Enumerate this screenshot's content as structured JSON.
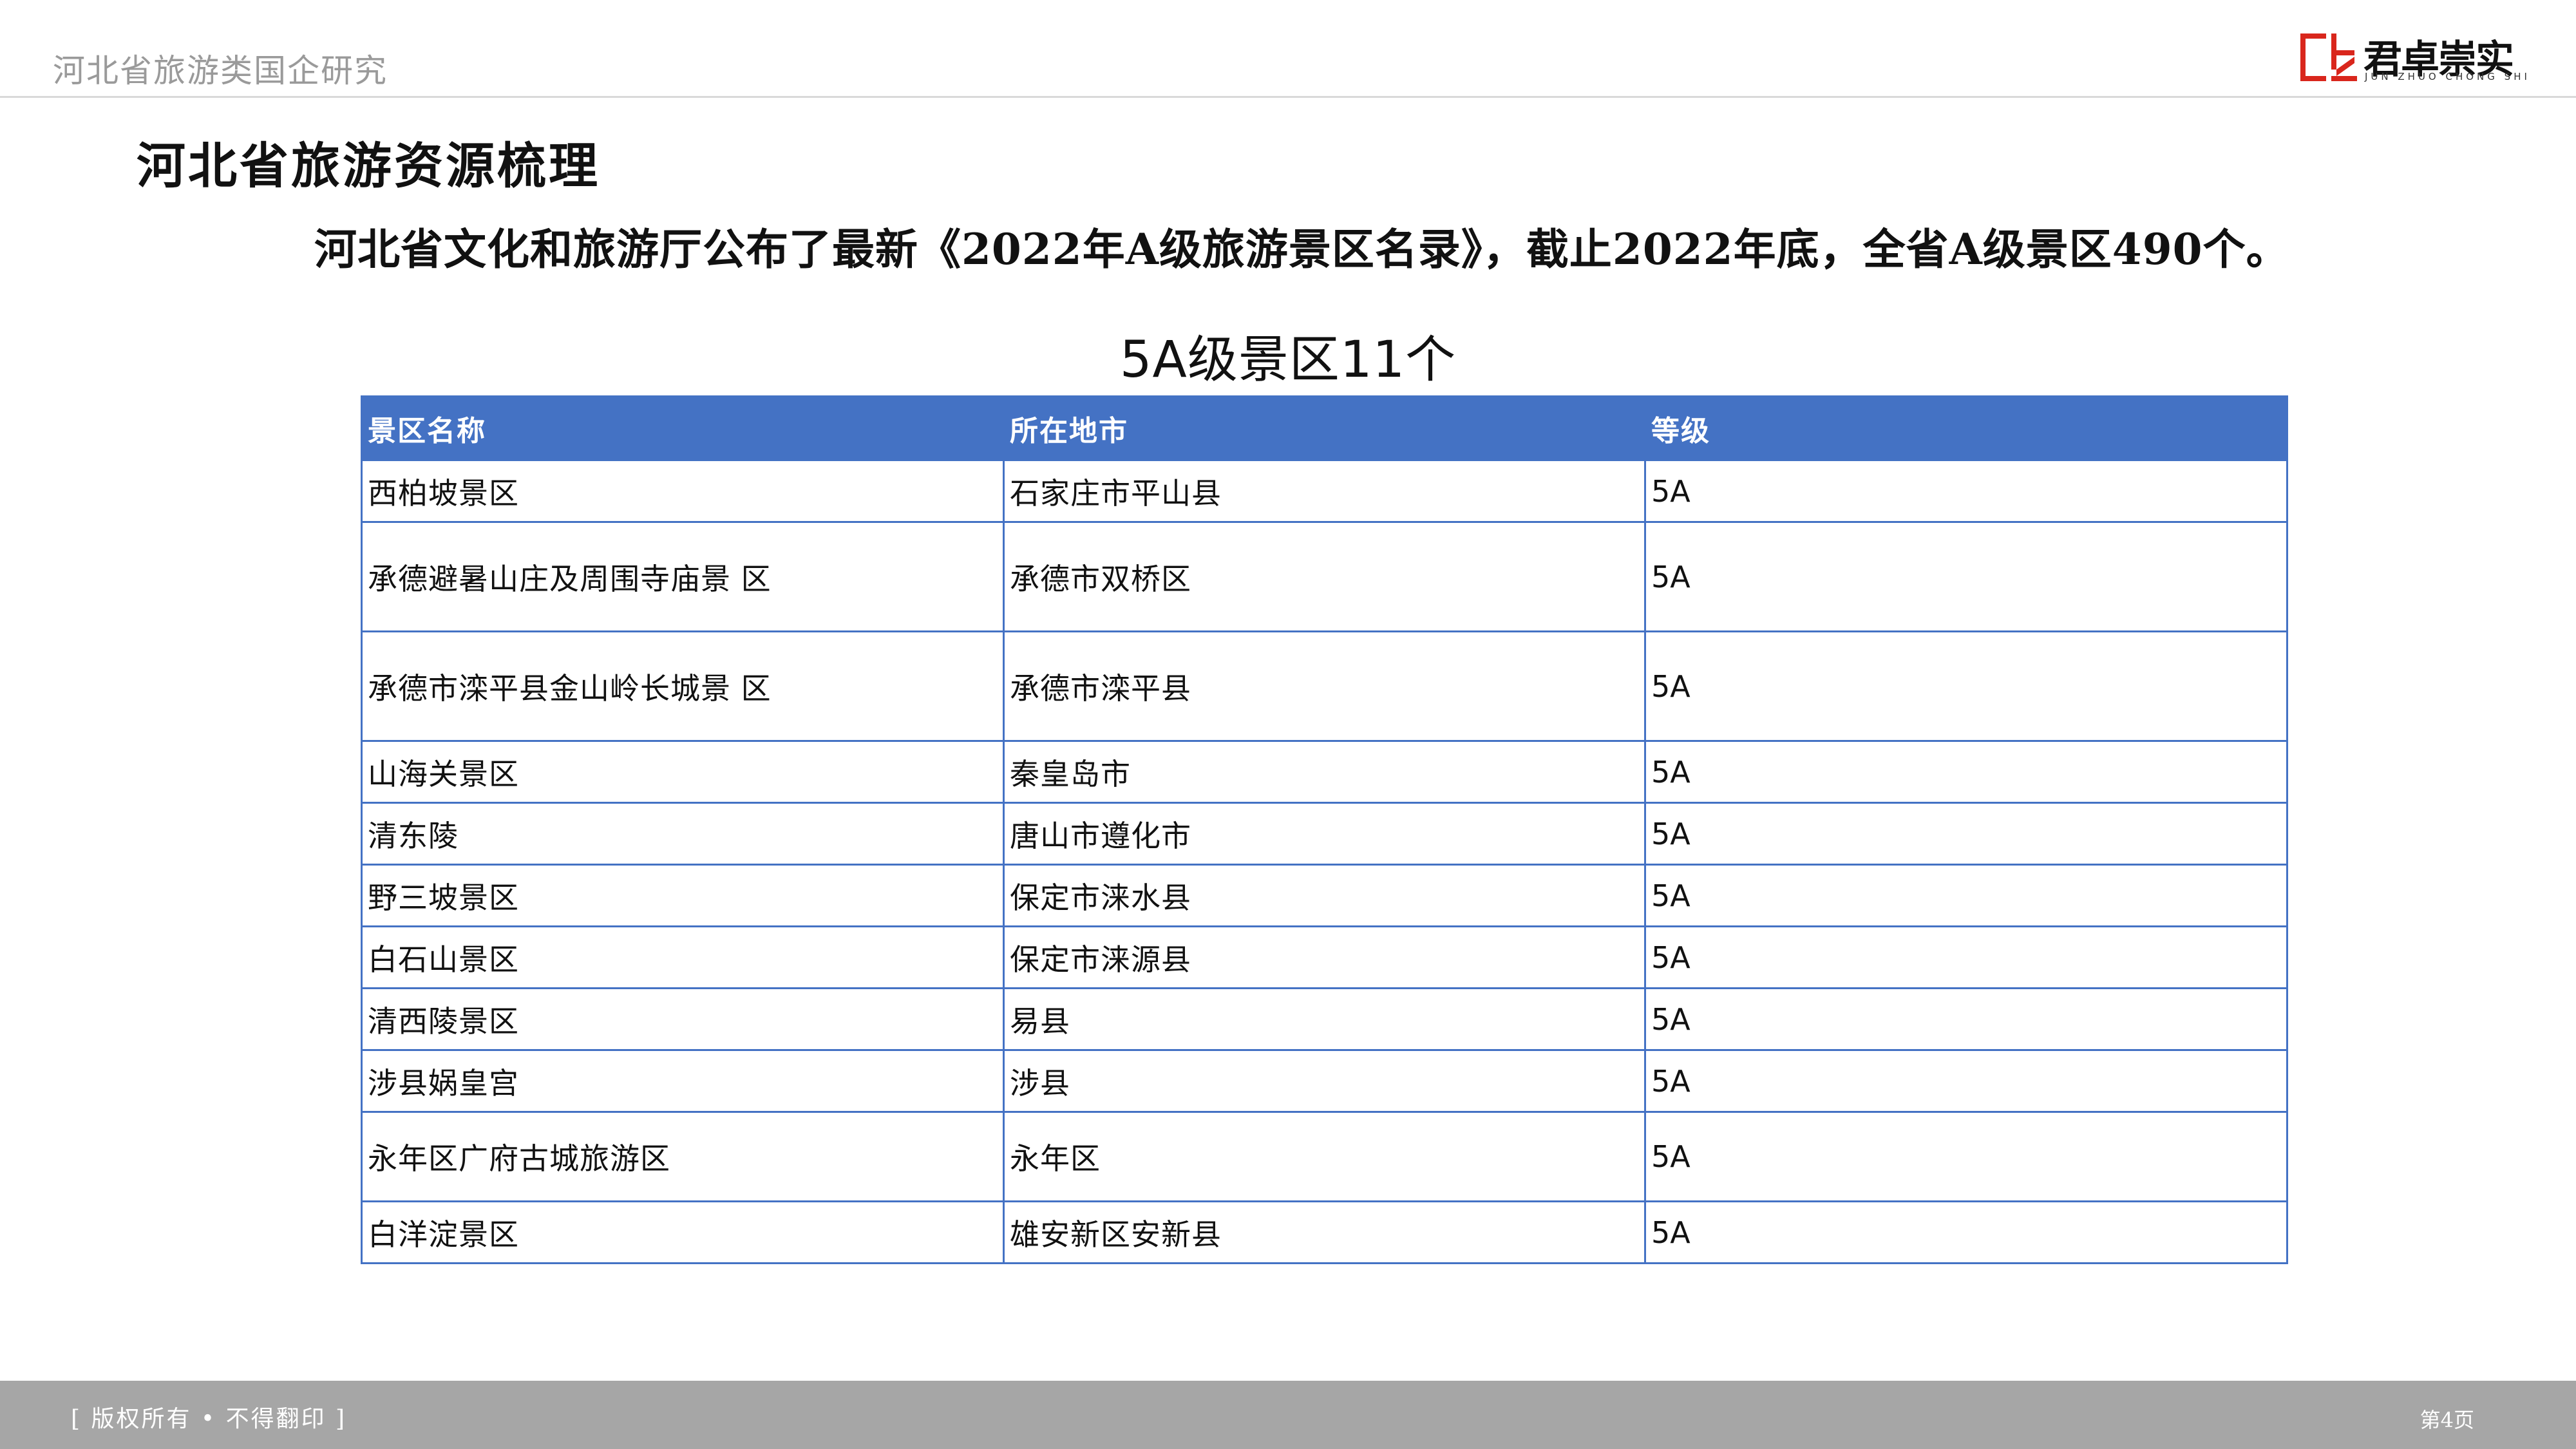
{
  "header": {
    "title": "河北省旅游类国企研究",
    "logo": {
      "name": "君卓崇实",
      "subtitle": "JUN ZHUO CHONG SHI",
      "colors": {
        "red": "#d9261c",
        "dark": "#111111"
      }
    }
  },
  "section_title": "河北省旅游资源梳理",
  "subtitle": "河北省文化和旅游厅公布了最新《2022年A级旅游景区名录》，截止2022年底，全省A级景区490个。",
  "table": {
    "caption": "5A级景区11个",
    "header_color": "#4472c4",
    "columns": [
      "景区名称",
      "所在地市",
      "等级"
    ],
    "rows": [
      [
        "西柏坡景区",
        "石家庄市平山县",
        "5A"
      ],
      [
        "承德避暑山庄及周围寺庙景 区",
        "承德市双桥区",
        "5A"
      ],
      [
        "承德市滦平县金山岭长城景 区",
        "承德市滦平县",
        "5A"
      ],
      [
        "山海关景区",
        "秦皇岛市",
        "5A"
      ],
      [
        "清东陵",
        "唐山市遵化市",
        "5A"
      ],
      [
        "野三坡景区",
        "保定市涞水县",
        "5A"
      ],
      [
        "白石山景区",
        "保定市涞源县",
        "5A"
      ],
      [
        "清西陵景区",
        "易县",
        "5A"
      ],
      [
        "涉县娲皇宫",
        "涉县",
        "5A"
      ],
      [
        "永年区广府古城旅游区",
        "永年区",
        "5A"
      ],
      [
        "白洋淀景区",
        "雄安新区安新县",
        "5A"
      ]
    ]
  },
  "footer": {
    "copyright": "[ 版权所有 • 不得翻印 ]",
    "page": "第4页",
    "background": "#a6a6a6"
  }
}
